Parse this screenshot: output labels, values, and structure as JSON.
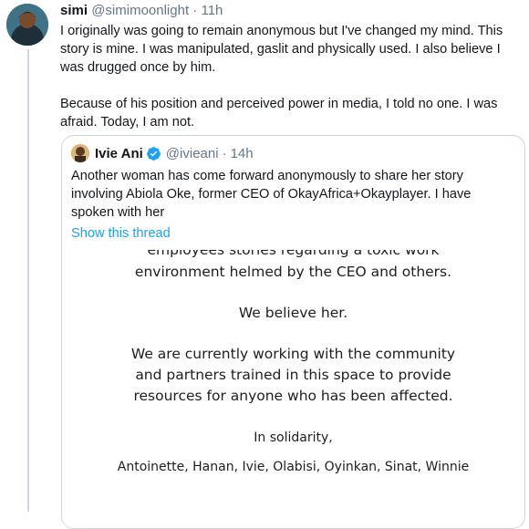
{
  "tweet": {
    "display_name": "simi",
    "handle": "@simimoonlight",
    "separator": "·",
    "time": "11h",
    "paragraphs": [
      "I originally was going to remain anonymous but I've changed my mind. This story is mine. I was manipulated, gaslit and physically used. I also believe I was drugged once by him.",
      "Because of his position and perceived power in media, I told no one. I was afraid. Today, I am not."
    ]
  },
  "quoted": {
    "display_name": "Ivie Ani",
    "handle": "@ivieani",
    "separator": "·",
    "time": "14h",
    "text": "Another woman has come forward anonymously to share her story involving Abiola Oke, former CEO of OkayAfrica+Okayplayer. I have spoken with her",
    "show_thread": "Show this thread",
    "image_lines": {
      "cut": "employees stories regarding a toxic work",
      "l1": "environment helmed by the CEO and others.",
      "l2": "We believe her.",
      "l3": "We are currently working with the community",
      "l4": "and partners trained in this space to provide",
      "l5": "resources for anyone who has been affected.",
      "l6": "In solidarity,",
      "l7": "Antoinette, Hanan, Ivie, Olabisi, Oyinkan, Sinat, Winnie"
    }
  },
  "colors": {
    "link": "#1da1f2",
    "muted": "#657786",
    "verified": "#1da1f2",
    "thread_line": "#cdd6dd"
  },
  "icons": {
    "verified": "verified-badge-icon"
  }
}
